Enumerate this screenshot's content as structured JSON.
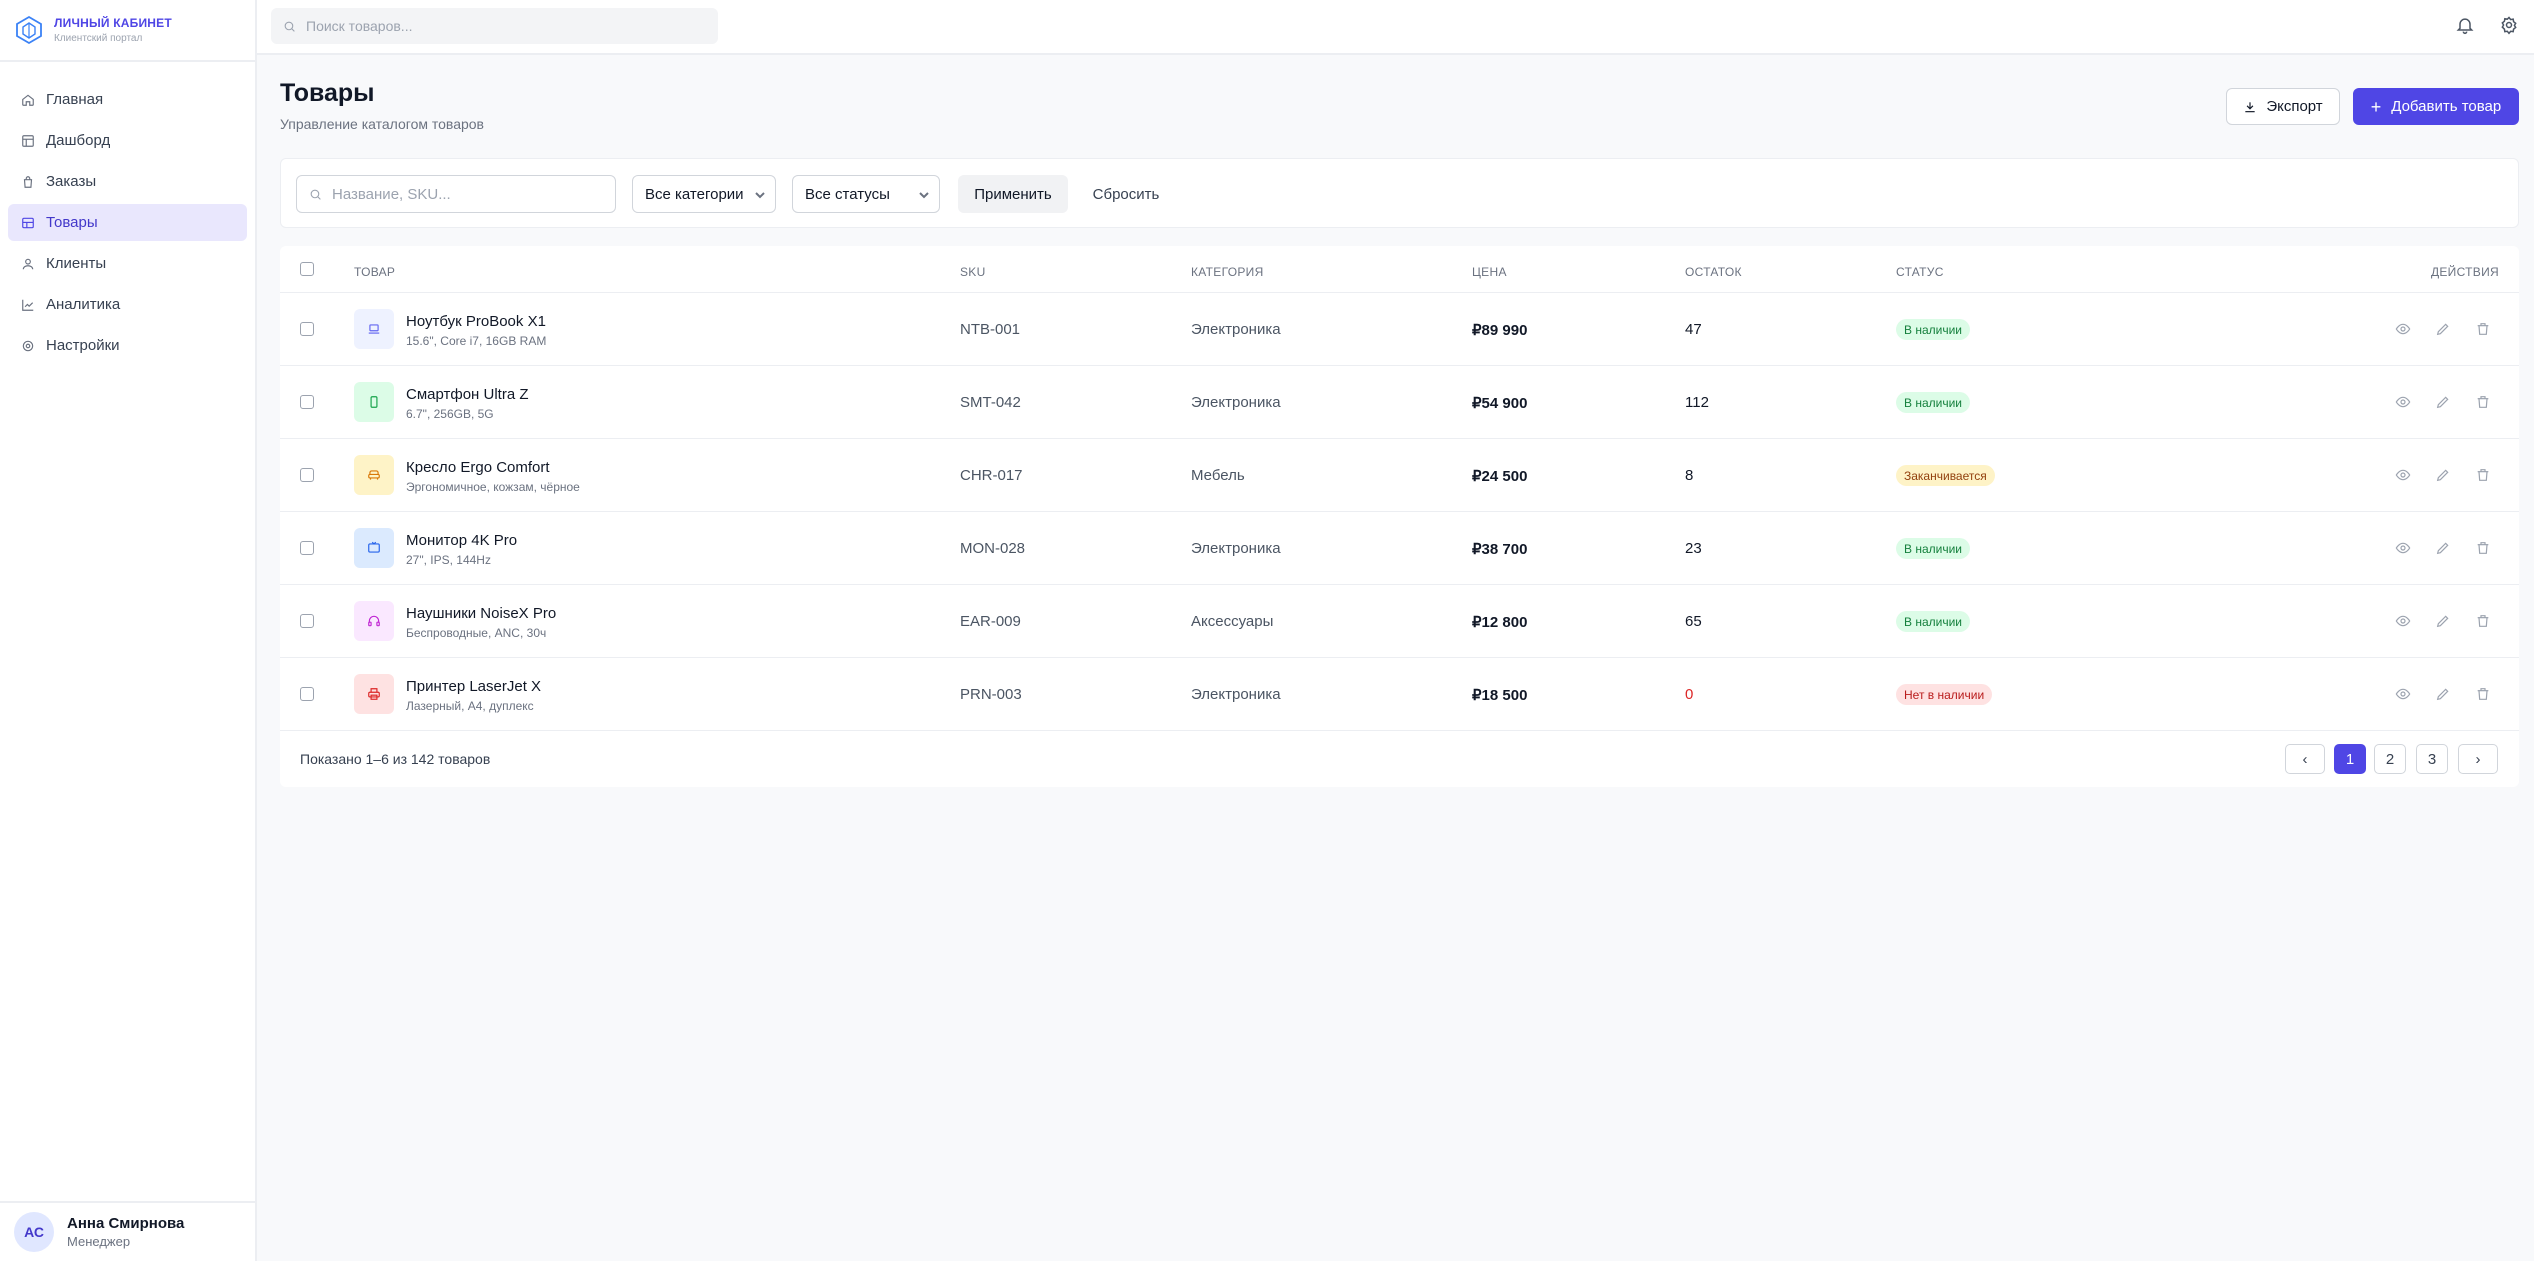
{
  "brand": {
    "title": "ЛИЧНЫЙ КАБИНЕТ",
    "subtitle": "Клиентский портал"
  },
  "sidebar": {
    "items": [
      {
        "label": "Главная",
        "icon": "home-icon"
      },
      {
        "label": "Дашборд",
        "icon": "dashboard-icon"
      },
      {
        "label": "Заказы",
        "icon": "orders-icon"
      },
      {
        "label": "Товары",
        "icon": "products-icon",
        "active": true
      },
      {
        "label": "Клиенты",
        "icon": "clients-icon"
      },
      {
        "label": "Аналитика",
        "icon": "analytics-icon"
      },
      {
        "label": "Настройки",
        "icon": "settings-icon"
      }
    ]
  },
  "user": {
    "initials": "АС",
    "name": "Анна Смирнова",
    "role": "Менеджер"
  },
  "topbar": {
    "search_placeholder": "Поиск товаров..."
  },
  "header": {
    "title": "Товары",
    "subtitle": "Управление каталогом товаров",
    "export_label": "Экспорт",
    "add_label": "Добавить товар"
  },
  "filters": {
    "search_placeholder": "Название, SKU...",
    "category": "Все категории",
    "status": "Все статусы",
    "apply_label": "Применить",
    "reset_label": "Сбросить"
  },
  "table": {
    "columns": {
      "product": "ТОВАР",
      "sku": "SKU",
      "category": "КАТЕГОРИЯ",
      "price": "ЦЕНА",
      "stock": "ОСТАТОК",
      "status": "СТАТУС",
      "actions": "ДЕЙСТВИЯ"
    },
    "rows": [
      {
        "name": "Ноутбук ProBook X1",
        "desc": "15.6\", Core i7, 16GB RAM",
        "sku": "NTB-001",
        "category": "Электроника",
        "price": "₽89 990",
        "stock": "47",
        "status": "В наличии",
        "icon": "laptop-icon"
      },
      {
        "name": "Смартфон Ultra Z",
        "desc": "6.7\", 256GB, 5G",
        "sku": "SMT-042",
        "category": "Электроника",
        "price": "₽54 900",
        "stock": "112",
        "status": "В наличии",
        "icon": "smartphone-icon"
      },
      {
        "name": "Кресло Ergo Comfort",
        "desc": "Эргономичное, кожзам, чёрное",
        "sku": "CHR-017",
        "category": "Мебель",
        "price": "₽24 500",
        "stock": "8",
        "status": "Заканчивается",
        "icon": "chair-icon"
      },
      {
        "name": "Монитор 4K Pro",
        "desc": "27\", IPS, 144Hz",
        "sku": "MON-028",
        "category": "Электроника",
        "price": "₽38 700",
        "stock": "23",
        "status": "В наличии",
        "icon": "monitor-icon"
      },
      {
        "name": "Наушники NoiseX Pro",
        "desc": "Беспроводные, ANC, 30ч",
        "sku": "EAR-009",
        "category": "Аксессуары",
        "price": "₽12 800",
        "stock": "65",
        "status": "В наличии",
        "icon": "headphones-icon"
      },
      {
        "name": "Принтер LaserJet X",
        "desc": "Лазерный, A4, дуплекс",
        "sku": "PRN-003",
        "category": "Электроника",
        "price": "₽18 500",
        "stock": "0",
        "status": "Нет в наличии",
        "icon": "printer-icon"
      }
    ]
  },
  "pagination": {
    "summary": "Показано 1–6 из 142 товаров",
    "prev": "‹",
    "next": "›",
    "pages": [
      "1",
      "2",
      "3"
    ],
    "current": "1"
  },
  "colors": {
    "accent": "#4f46e5",
    "in_stock_bg": "#dcfce7",
    "in_stock_text": "#15803d",
    "low_stock_bg": "#fef3c7",
    "low_stock_text": "#92400e",
    "out_stock_bg": "#fee2e2",
    "out_stock_text": "#b91c1c"
  }
}
